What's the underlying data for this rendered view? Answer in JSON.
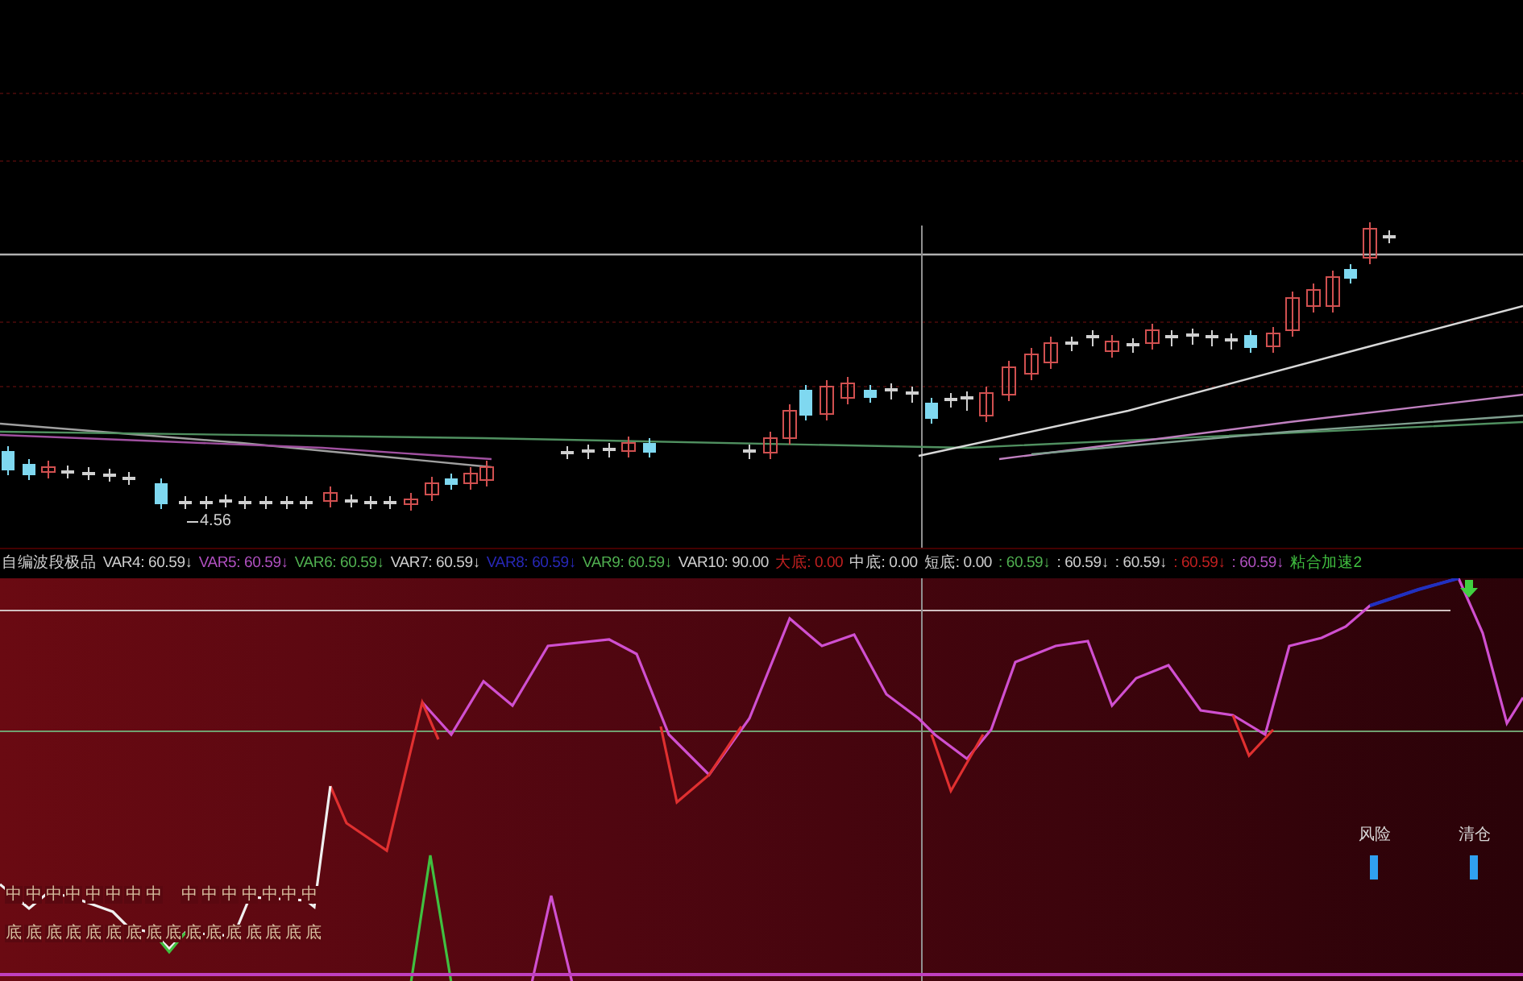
{
  "main_chart": {
    "low_label": "4.56"
  },
  "indicator_bar": {
    "title": "自编波段极品",
    "items": [
      {
        "text": "VAR4: 60.59↓",
        "color": "#d0d0d0"
      },
      {
        "text": "VAR5: 60.59↓",
        "color": "#b050c0"
      },
      {
        "text": "VAR6: 60.59↓",
        "color": "#50b050"
      },
      {
        "text": "VAR7: 60.59↓",
        "color": "#d0d0d0"
      },
      {
        "text": "VAR8: 60.59↓",
        "color": "#2828b8"
      },
      {
        "text": "VAR9: 60.59↓",
        "color": "#50b050"
      },
      {
        "text": "VAR10: 90.00",
        "color": "#d0d0d0"
      },
      {
        "text": "大底: 0.00",
        "color": "#c02020"
      },
      {
        "text": "中底: 0.00",
        "color": "#d0d0d0"
      },
      {
        "text": "短底: 0.00",
        "color": "#d0d0d0"
      },
      {
        "text": ": 60.59↓",
        "color": "#50b050"
      },
      {
        "text": ": 60.59↓",
        "color": "#d0d0d0"
      },
      {
        "text": ": 60.59↓",
        "color": "#d0d0d0"
      },
      {
        "text": ": 60.59↓",
        "color": "#c02020"
      },
      {
        "text": ": 60.59↓",
        "color": "#b050c0"
      },
      {
        "text": "粘合加速2",
        "color": "#40c040"
      }
    ]
  },
  "indicator_panel": {
    "middle_markers": [
      "中",
      "中",
      "中",
      "中",
      "中",
      "中",
      "中",
      "中",
      "中",
      "中",
      "中",
      "中",
      "中",
      "中",
      "中"
    ],
    "bottom_markers": [
      "底",
      "底",
      "底",
      "底",
      "底",
      "底",
      "底",
      "底",
      "底",
      "底",
      "底",
      "底",
      "底",
      "底",
      "底",
      "底"
    ],
    "signals": [
      {
        "label": "风险"
      },
      {
        "label": "清仓"
      }
    ]
  }
}
